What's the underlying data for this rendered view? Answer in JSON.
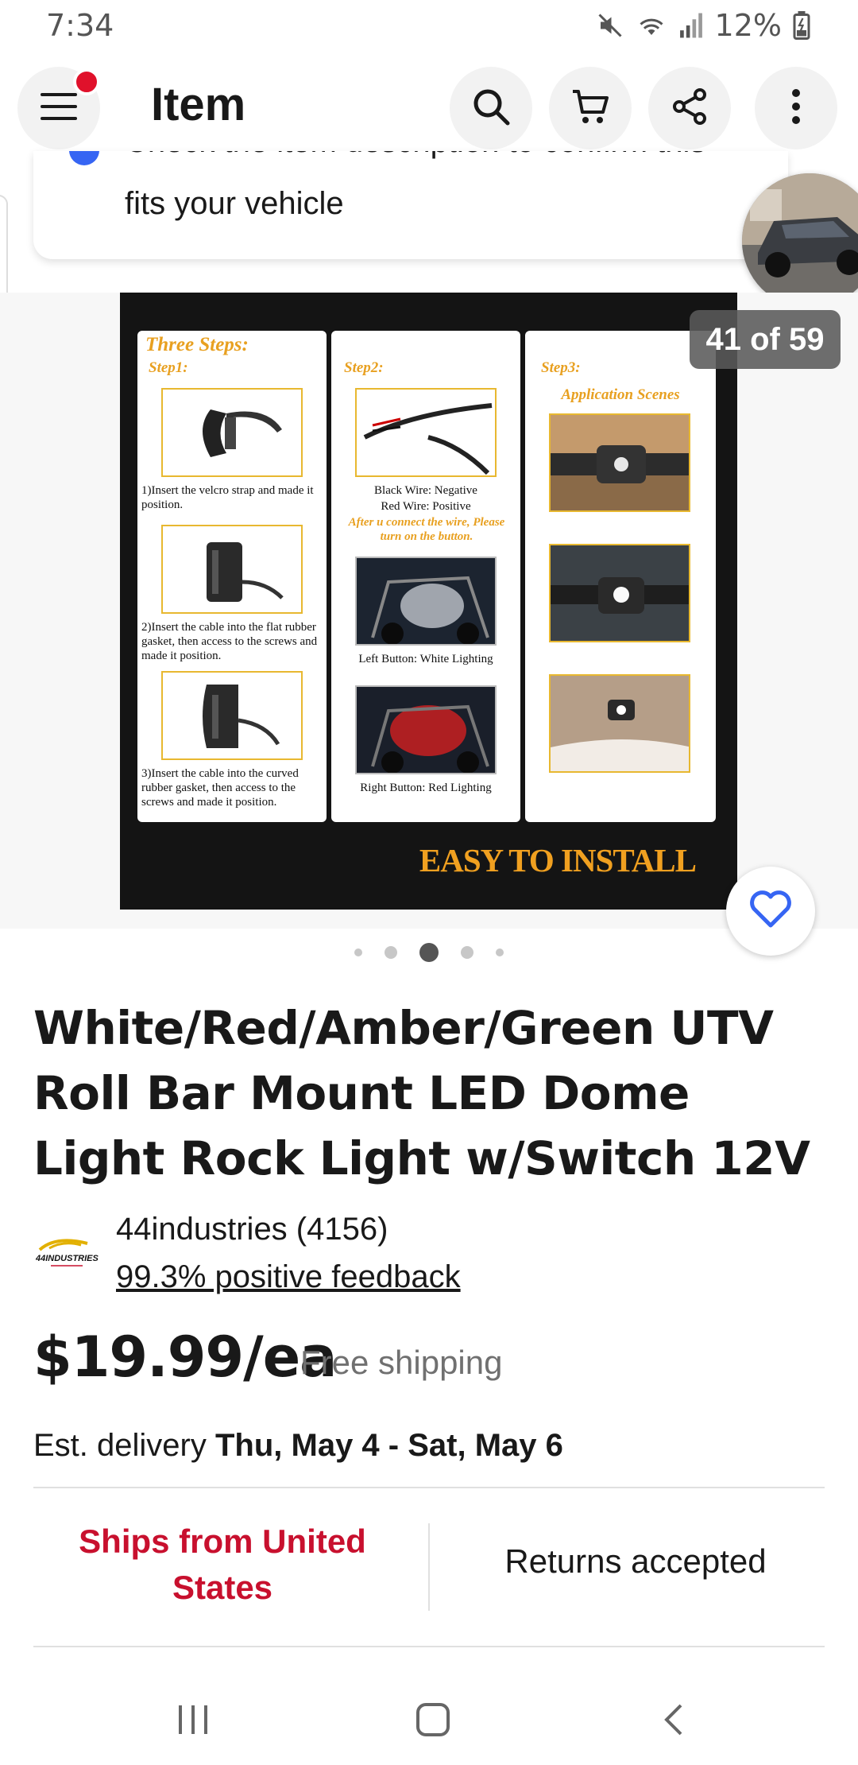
{
  "status_bar": {
    "time": "7:34",
    "battery": "12%"
  },
  "app_bar": {
    "title": "Item",
    "icons": [
      "menu-icon",
      "search-icon",
      "cart-icon",
      "share-icon",
      "more-vert-icon"
    ]
  },
  "compat": {
    "cut_line": "Check the item description to confirm this",
    "text": "fits your vehicle"
  },
  "gallery": {
    "counter": "41 of 59",
    "image": {
      "title": "Three Steps:",
      "step1": "Step1:",
      "step2": "Step2:",
      "step3": "Step3:",
      "step1_a": "1)Insert the velcro strap and made it position.",
      "step1_b": "2)Insert the cable into the flat rubber gasket, then access to the screws and made it position.",
      "step1_c": "3)Insert the cable into the curved rubber gasket, then access to the screws and made it position.",
      "black_wire": "Black Wire: Negative",
      "red_wire": "Red Wire: Positive",
      "after_connect": "After u connect the wire, Please turn on the button.",
      "left_button": "Left Button: White Lighting",
      "right_button": "Right Button: Red Lighting",
      "application_scenes": "Application Scenes",
      "easy": "EASY TO INSTALL"
    },
    "dots_count": 5,
    "active_dot": 2
  },
  "item": {
    "title": "White/Red/Amber/Green UTV Roll Bar Mount LED Dome Light Rock Light w/Switch 12V"
  },
  "seller": {
    "logo_text": "44INDUSTRIES",
    "name": "44industries (4156)",
    "feedback": "99.3% positive feedback"
  },
  "price": {
    "amount": "$19.99/ea",
    "shipping": "Free shipping"
  },
  "delivery": {
    "label": "Est. delivery ",
    "dates": "Thu, May 4 - Sat, May 6"
  },
  "info": {
    "ships_from": "Ships from United States",
    "returns": "Returns accepted"
  },
  "colors": {
    "accent_red": "#c8102e",
    "link_blue": "#3665f3",
    "image_orange": "#f0a020"
  }
}
